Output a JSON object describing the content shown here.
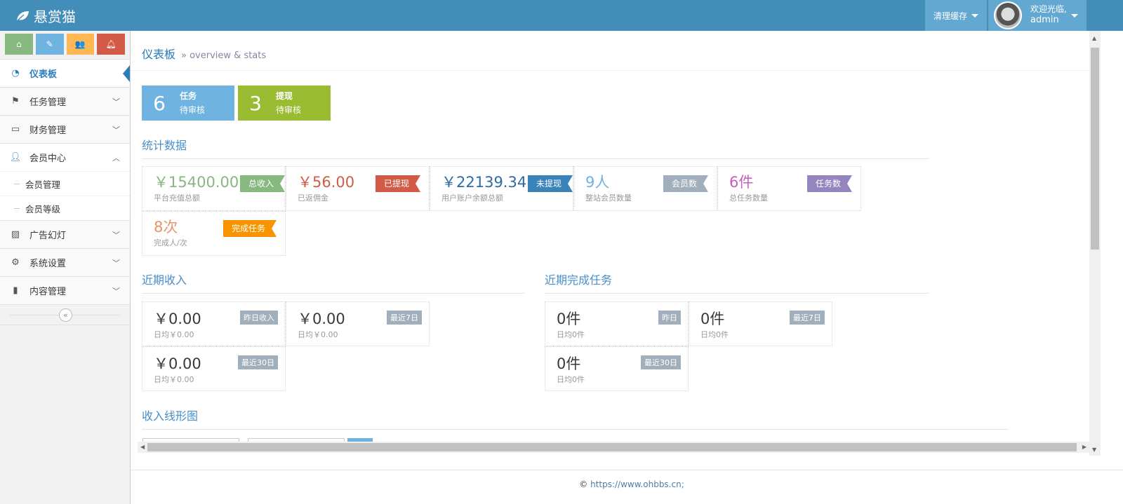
{
  "app": {
    "title": "悬赏猫",
    "logo_icon": "leaf-icon"
  },
  "header": {
    "clear_cache": "清理缓存",
    "welcome": "欢迎光临,",
    "username": "admin"
  },
  "shortcuts": [
    {
      "icon": "home-icon",
      "color": "#87b87f"
    },
    {
      "icon": "pencil-icon",
      "color": "#6fb3e0"
    },
    {
      "icon": "users-icon",
      "color": "#ffb752"
    },
    {
      "icon": "bell-icon",
      "color": "#d15b47"
    }
  ],
  "sidebar": {
    "items": [
      {
        "label": "仪表板",
        "icon": "dashboard-icon"
      },
      {
        "label": "任务管理",
        "icon": "flag-icon"
      },
      {
        "label": "财务管理",
        "icon": "hdd-icon"
      },
      {
        "label": "会员中心",
        "icon": "user-icon"
      },
      {
        "label": "广告幻灯",
        "icon": "picture-icon"
      },
      {
        "label": "系统设置",
        "icon": "gear-icon"
      },
      {
        "label": "内容管理",
        "icon": "book-icon"
      }
    ],
    "sub_items": [
      "会员管理",
      "会员等级"
    ],
    "collapse": "«"
  },
  "breadcrumb": {
    "title": "仪表板",
    "subtitle": "» overview & stats"
  },
  "infoboxes": [
    {
      "num": "6",
      "l1": "任务",
      "l2": "待审核",
      "color": "#6fb3e0"
    },
    {
      "num": "3",
      "l1": "提现",
      "l2": "待审核",
      "color": "#9abc32"
    }
  ],
  "sections": {
    "stats": "统计数据",
    "income": "近期收入",
    "tasks": "近期完成任务",
    "chart": "收入线形图"
  },
  "stats": [
    {
      "value": "￥15400.00",
      "desc": "平台充值总额",
      "badge": "总收入",
      "color": "#87b87f",
      "badge_color": "#87b87f"
    },
    {
      "value": "￥56.00",
      "desc": "已返佣金",
      "badge": "已提现",
      "color": "#d15b47",
      "badge_color": "#d15b47"
    },
    {
      "value": "￥22139.34",
      "desc": "用户账户余额总额",
      "badge": "未提现",
      "color": "#2e6ba6",
      "badge_color": "#3983b9"
    },
    {
      "value": "9人",
      "desc": "整站会员数量",
      "badge": "会员数",
      "color": "#6fb3e0",
      "badge_color": "#a0afbb"
    },
    {
      "value": "6件",
      "desc": "总任务数量",
      "badge": "任务数",
      "color": "#c55fbb",
      "badge_color": "#9585bf"
    },
    {
      "value": "8次",
      "desc": "完成人/次",
      "badge": "完成任务",
      "color": "#e8956a",
      "badge_color": "#f79400"
    }
  ],
  "income": [
    {
      "value": "￥0.00",
      "avg": "日均￥0.00",
      "tag": "昨日收入"
    },
    {
      "value": "￥0.00",
      "avg": "日均￥0.00",
      "tag": "最近7日"
    },
    {
      "value": "￥0.00",
      "avg": "日均￥0.00",
      "tag": "最近30日"
    }
  ],
  "tasks": [
    {
      "value": "0件",
      "avg": "日均0件",
      "tag": "昨日"
    },
    {
      "value": "0件",
      "avg": "日均0件",
      "tag": "最近7日"
    },
    {
      "value": "0件",
      "avg": "日均0件",
      "tag": "最近30日"
    }
  ],
  "footer": {
    "copyright": "©",
    "link": "https://www.ohbbs.cn;"
  }
}
